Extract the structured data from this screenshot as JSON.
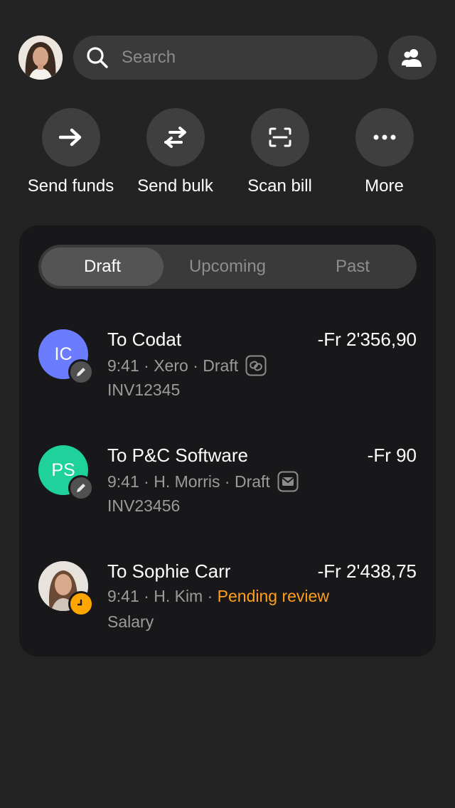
{
  "search": {
    "placeholder": "Search"
  },
  "quick_actions": [
    {
      "label": "Send funds",
      "icon": "arrow-right-icon"
    },
    {
      "label": "Send bulk",
      "icon": "swap-arrows-icon"
    },
    {
      "label": "Scan bill",
      "icon": "scan-icon"
    },
    {
      "label": "More",
      "icon": "more-dots-icon"
    }
  ],
  "tabs": [
    {
      "label": "Draft",
      "active": true
    },
    {
      "label": "Upcoming",
      "active": false
    },
    {
      "label": "Past",
      "active": false
    }
  ],
  "transactions": [
    {
      "initials": "IC",
      "avatar_color": "#6b7cff",
      "title": "To Codat",
      "amount": "-Fr 2'356,90",
      "time": "9:41",
      "source": "Xero",
      "status": "Draft",
      "status_icon": "link-icon",
      "ref": "INV12345",
      "badge_icon": "pencil-icon"
    },
    {
      "initials": "PS",
      "avatar_color": "#1fd19a",
      "title": "To P&C Software",
      "amount": "-Fr 90",
      "time": "9:41",
      "source": "H. Morris",
      "status": "Draft",
      "status_icon": "mail-icon",
      "ref": "INV23456",
      "badge_icon": "pencil-icon"
    },
    {
      "initials": "",
      "avatar_color": "#d9d2ca",
      "title": "To Sophie Carr",
      "amount": "-Fr 2'438,75",
      "time": "9:41",
      "source": "H. Kim",
      "status": "Pending review",
      "ref": "Salary",
      "badge_icon": "clock-icon"
    }
  ],
  "colors": {
    "background": "#232323",
    "card": "#18181a",
    "pending": "#ff9f1a",
    "badge_pending": "#ffa500"
  }
}
